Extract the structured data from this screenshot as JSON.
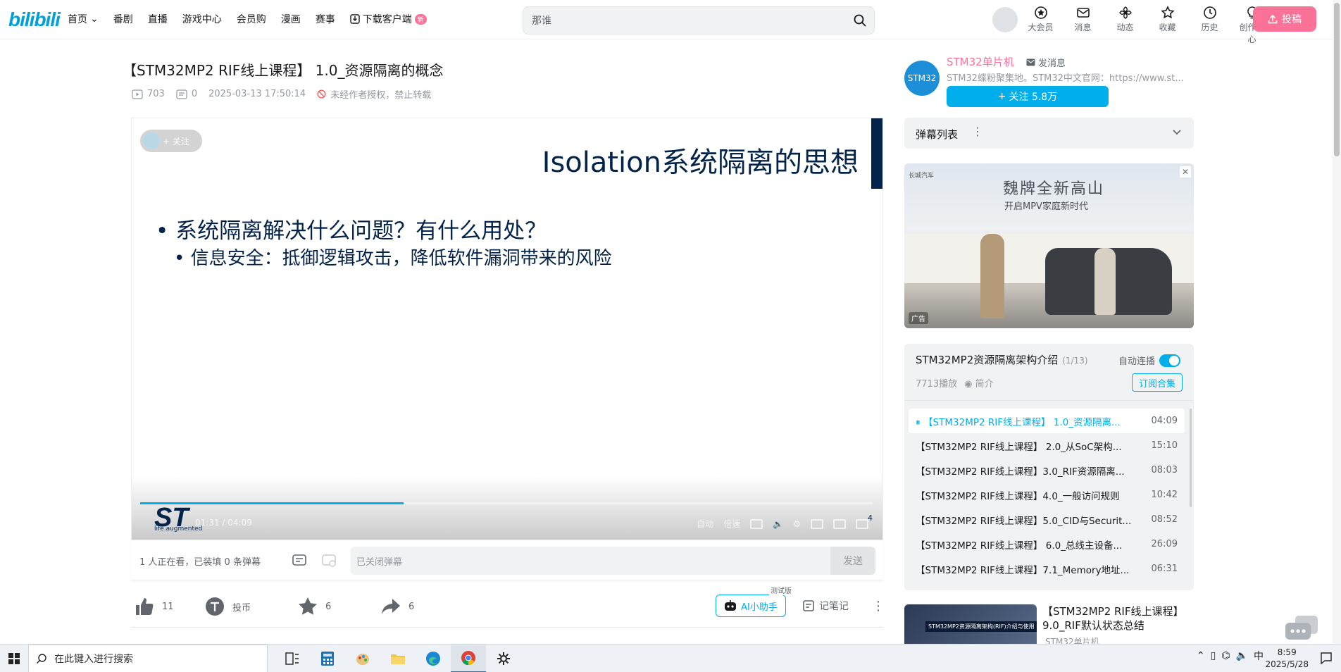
{
  "header": {
    "logo": "bilibili",
    "nav": [
      {
        "label": "首页",
        "dropdown": true
      },
      {
        "label": "番剧"
      },
      {
        "label": "直播"
      },
      {
        "label": "游戏中心"
      },
      {
        "label": "会员购"
      },
      {
        "label": "漫画"
      },
      {
        "label": "赛事"
      },
      {
        "label": "下载客户端",
        "badge": "新"
      }
    ],
    "search_value": "那谁",
    "right_icons": [
      {
        "label": "大会员",
        "icon": "vip-icon"
      },
      {
        "label": "消息",
        "icon": "message-icon"
      },
      {
        "label": "动态",
        "icon": "dynamic-icon"
      },
      {
        "label": "收藏",
        "icon": "star-icon"
      },
      {
        "label": "历史",
        "icon": "history-icon"
      },
      {
        "label": "创作中心",
        "icon": "lightbulb-icon"
      }
    ],
    "upload_label": "投稿"
  },
  "video": {
    "title": "【STM32MP2 RIF线上课程】 1.0_资源隔离的概念",
    "views": "703",
    "danmaku_count": "0",
    "date": "2025-03-13 17:50:14",
    "copyright": "未经作者授权，禁止转载",
    "slide": {
      "title": "Isolation系统隔离的思想",
      "bullet1": "系统隔离解决什么问题？有什么用处？",
      "bullet2": "信息安全：抵御逻辑攻击，降低软件漏洞带来的风险",
      "logo_tag": "life.augmented",
      "page": "4"
    },
    "follow_chip": "+ 关注",
    "time": "01:31 / 04:09",
    "progress": 0.36,
    "controls": [
      "自动",
      "倍速"
    ]
  },
  "danmaku": {
    "watching": "1 人正在看，已装填 0 条弹幕",
    "input_placeholder": "已关闭弹幕",
    "send": "发送"
  },
  "actions": {
    "like": "11",
    "coin": "投币",
    "favorite": "6",
    "share": "6",
    "ai": "AI小助手",
    "beta": "测试版",
    "note": "记笔记"
  },
  "uploader": {
    "name": "STM32单片机",
    "message": "发消息",
    "desc": "STM32蝶粉聚集地。STM32中文官网：https://www.st...",
    "follow": "关注 5.8万",
    "avatar_text": "STM32"
  },
  "danmaku_list": {
    "label": "弹幕列表"
  },
  "ad": {
    "headline": "魏牌全新高山",
    "sub": "开启MPV家庭新时代",
    "brand": "长城汽车",
    "tag": "广告"
  },
  "playlist": {
    "title": "STM32MP2资源隔离架构介绍",
    "count": "(1/13)",
    "autoplay": "自动连播",
    "plays": "7713播放",
    "intro": "简介",
    "subscribe": "订阅合集",
    "items": [
      {
        "label": "【STM32MP2 RIF线上课程】 1.0_资源隔离...",
        "dur": "04:09",
        "active": true
      },
      {
        "label": "【STM32MP2 RIF线上课程】 2.0_从SoC架构...",
        "dur": "15:10"
      },
      {
        "label": "【STM32MP2 RIF线上课程】3.0_RIF资源隔离...",
        "dur": "08:03"
      },
      {
        "label": "【STM32MP2 RIF线上课程】4.0_一般访问规则",
        "dur": "10:42"
      },
      {
        "label": "【STM32MP2 RIF线上课程】5.0_CID与Securit...",
        "dur": "08:52"
      },
      {
        "label": "【STM32MP2 RIF线上课程】 6.0_总线主设备...",
        "dur": "26:09"
      },
      {
        "label": "【STM32MP2 RIF线上课程】7.1_Memory地址...",
        "dur": "06:31"
      }
    ]
  },
  "recommend": {
    "title": "【STM32MP2 RIF线上课程】9.0_RIF默认状态总结",
    "up": "STM32单片机",
    "thumb_caption": "STM32MP2资源隔离架构(RIF)介绍与使用"
  },
  "taskbar": {
    "search": "在此键入进行搜索",
    "ime": "中",
    "time": "8:59",
    "date": "2025/5/28"
  }
}
